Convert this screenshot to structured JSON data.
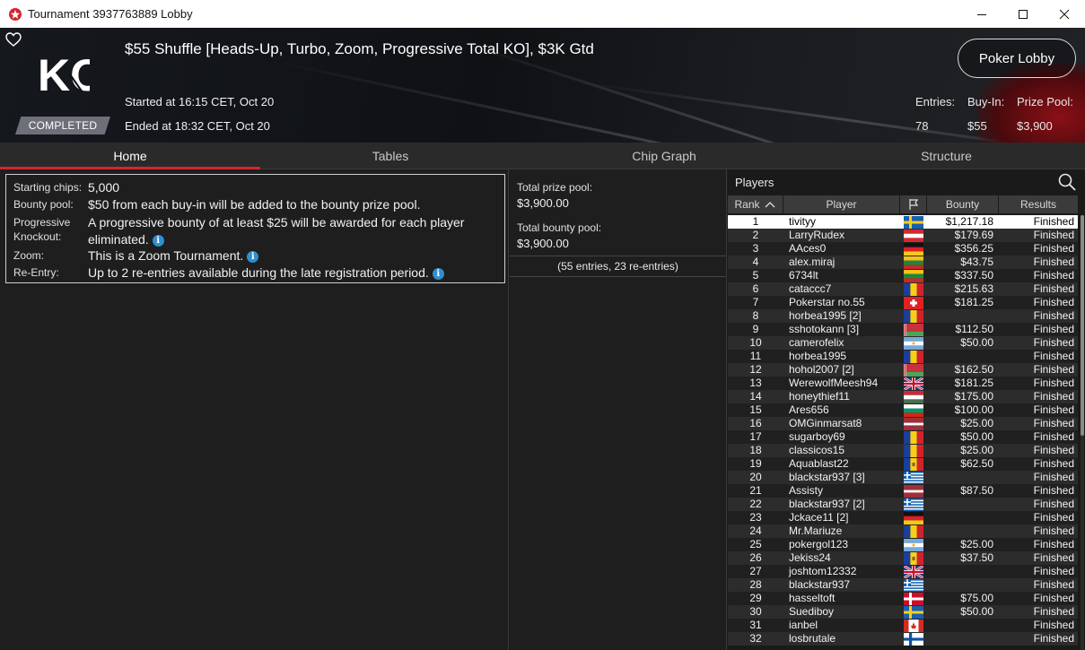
{
  "window": {
    "title": "Tournament 3937763889 Lobby"
  },
  "header": {
    "title": "$55 Shuffle [Heads-Up, Turbo, Zoom, Progressive Total KO], $3K Gtd",
    "logo_text": "KO",
    "status_badge": "COMPLETED",
    "started": "Started at 16:15 CET, Oct 20",
    "ended": "Ended at 18:32 CET, Oct 20",
    "lobby_button": "Poker Lobby",
    "entries_label": "Entries:",
    "entries_value": "78",
    "buyin_label": "Buy-In:",
    "buyin_value": "$55",
    "prizepool_label": "Prize Pool:",
    "prizepool_value": "$3,900"
  },
  "tabs": [
    {
      "label": "Home",
      "active": true
    },
    {
      "label": "Tables",
      "active": false
    },
    {
      "label": "Chip Graph",
      "active": false
    },
    {
      "label": "Structure",
      "active": false
    }
  ],
  "home": {
    "rows": [
      {
        "label": "Starting chips:",
        "value": "5,000",
        "info": false
      },
      {
        "label": "Bounty pool:",
        "value": "$50 from each buy-in will be added to the bounty prize pool.",
        "info": false
      },
      {
        "label": "Progressive Knockout:",
        "value": "A progressive bounty of at least $25 will be awarded for each player eliminated.",
        "info": true
      },
      {
        "label": "Zoom:",
        "value": "This is a Zoom Tournament.",
        "info": true
      },
      {
        "label": "Re-Entry:",
        "value": "Up to 2 re-entries available during the late registration period.",
        "info": true
      }
    ]
  },
  "prize": {
    "total_prize_label": "Total prize pool:",
    "total_prize_value": "$3,900.00",
    "total_bounty_label": "Total bounty pool:",
    "total_bounty_value": "$3,900.00",
    "entries_note": "(55 entries, 23 re-entries)"
  },
  "players": {
    "title": "Players",
    "columns": {
      "rank": "Rank",
      "player": "Player",
      "bounty": "Bounty",
      "results": "Results"
    },
    "rows": [
      {
        "rank": "1",
        "player": "tivityy",
        "flag": "se",
        "bounty": "$1,217.18",
        "result": "Finished"
      },
      {
        "rank": "2",
        "player": "LarryRudex",
        "flag": "at",
        "bounty": "$179.69",
        "result": "Finished"
      },
      {
        "rank": "3",
        "player": "AAces0",
        "flag": "de",
        "bounty": "$356.25",
        "result": "Finished"
      },
      {
        "rank": "4",
        "player": "alex.miraj",
        "flag": "lt",
        "bounty": "$43.75",
        "result": "Finished"
      },
      {
        "rank": "5",
        "player": "6734lt",
        "flag": "lt",
        "bounty": "$337.50",
        "result": "Finished"
      },
      {
        "rank": "6",
        "player": "cataccc7",
        "flag": "ro",
        "bounty": "$215.63",
        "result": "Finished"
      },
      {
        "rank": "7",
        "player": "Pokerstar no.55",
        "flag": "ch",
        "bounty": "$181.25",
        "result": "Finished"
      },
      {
        "rank": "8",
        "player": "horbea1995 [2]",
        "flag": "ro",
        "bounty": "",
        "result": "Finished"
      },
      {
        "rank": "9",
        "player": "sshotokann [3]",
        "flag": "by",
        "bounty": "$112.50",
        "result": "Finished"
      },
      {
        "rank": "10",
        "player": "camerofelix",
        "flag": "ar",
        "bounty": "$50.00",
        "result": "Finished"
      },
      {
        "rank": "11",
        "player": "horbea1995",
        "flag": "ro",
        "bounty": "",
        "result": "Finished"
      },
      {
        "rank": "12",
        "player": "hohol2007 [2]",
        "flag": "by",
        "bounty": "$162.50",
        "result": "Finished"
      },
      {
        "rank": "13",
        "player": "WerewolfMeesh94",
        "flag": "gb",
        "bounty": "$181.25",
        "result": "Finished"
      },
      {
        "rank": "14",
        "player": "honeythief11",
        "flag": "hu",
        "bounty": "$175.00",
        "result": "Finished"
      },
      {
        "rank": "15",
        "player": "Ares656",
        "flag": "bg",
        "bounty": "$100.00",
        "result": "Finished"
      },
      {
        "rank": "16",
        "player": "OMGinmarsat8",
        "flag": "lv",
        "bounty": "$25.00",
        "result": "Finished"
      },
      {
        "rank": "17",
        "player": "sugarboy69",
        "flag": "ro",
        "bounty": "$50.00",
        "result": "Finished"
      },
      {
        "rank": "18",
        "player": "classicos15",
        "flag": "ro",
        "bounty": "$25.00",
        "result": "Finished"
      },
      {
        "rank": "19",
        "player": "Aquablast22",
        "flag": "md",
        "bounty": "$62.50",
        "result": "Finished"
      },
      {
        "rank": "20",
        "player": "blackstar937 [3]",
        "flag": "gr",
        "bounty": "",
        "result": "Finished"
      },
      {
        "rank": "21",
        "player": "Assisty",
        "flag": "lv",
        "bounty": "$87.50",
        "result": "Finished"
      },
      {
        "rank": "22",
        "player": "blackstar937 [2]",
        "flag": "gr",
        "bounty": "",
        "result": "Finished"
      },
      {
        "rank": "23",
        "player": "Jckace11 [2]",
        "flag": "de",
        "bounty": "",
        "result": "Finished"
      },
      {
        "rank": "24",
        "player": "Mr.Mariuze",
        "flag": "ro",
        "bounty": "",
        "result": "Finished"
      },
      {
        "rank": "25",
        "player": "pokergol123",
        "flag": "ar",
        "bounty": "$25.00",
        "result": "Finished"
      },
      {
        "rank": "26",
        "player": "Jekiss24",
        "flag": "md",
        "bounty": "$37.50",
        "result": "Finished"
      },
      {
        "rank": "27",
        "player": "joshtom12332",
        "flag": "gb",
        "bounty": "",
        "result": "Finished"
      },
      {
        "rank": "28",
        "player": "blackstar937",
        "flag": "gr",
        "bounty": "",
        "result": "Finished"
      },
      {
        "rank": "29",
        "player": "hasseltoft",
        "flag": "dk",
        "bounty": "$75.00",
        "result": "Finished"
      },
      {
        "rank": "30",
        "player": "Suediboy",
        "flag": "se",
        "bounty": "$50.00",
        "result": "Finished"
      },
      {
        "rank": "31",
        "player": "ianbel",
        "flag": "ca",
        "bounty": "",
        "result": "Finished"
      },
      {
        "rank": "32",
        "player": "losbrutale",
        "flag": "fi",
        "bounty": "",
        "result": "Finished"
      }
    ]
  },
  "colors": {
    "accent": "#d6252f",
    "info": "#2f8fd0"
  }
}
